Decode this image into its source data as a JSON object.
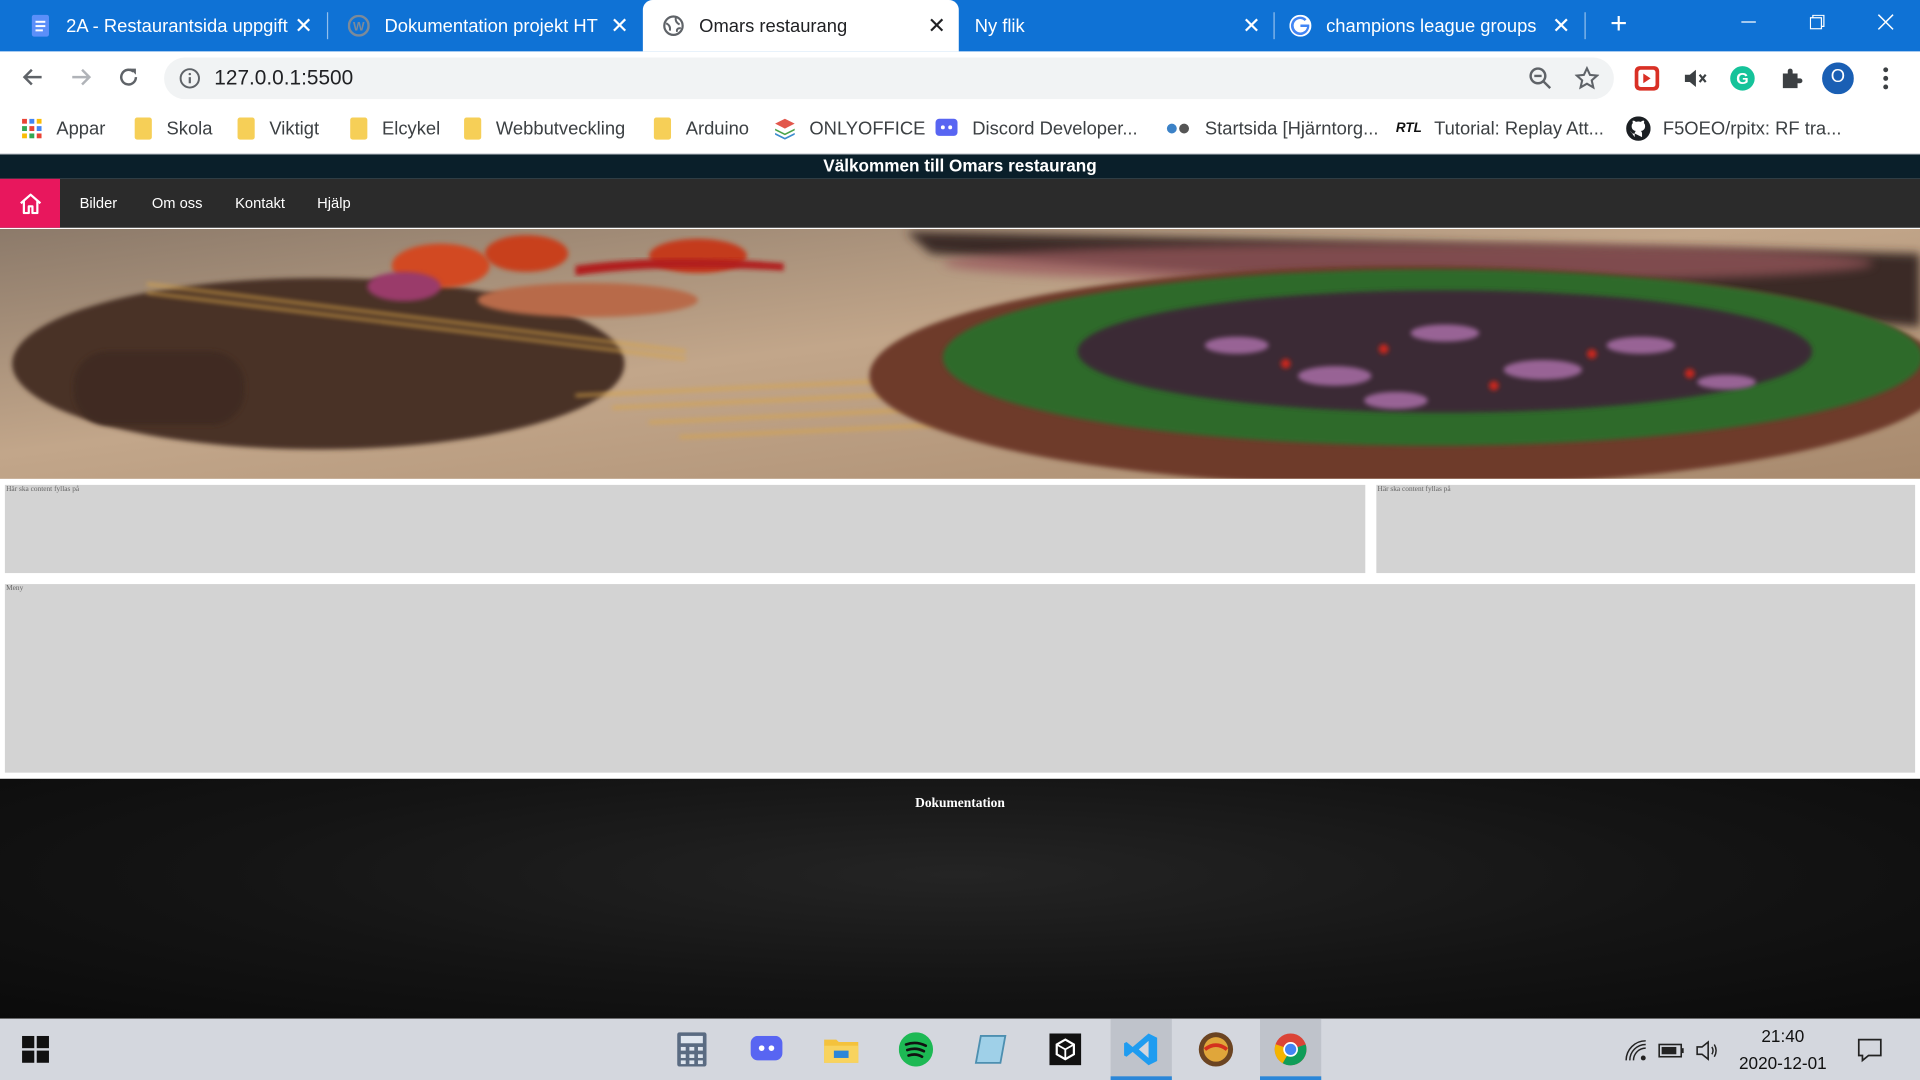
{
  "browser": {
    "tabs": [
      {
        "title": "2A - Restaurantsida uppgift",
        "icon": "google-docs-icon"
      },
      {
        "title": "Dokumentation projekt HT",
        "icon": "wordpress-icon"
      },
      {
        "title": "Omars restaurang",
        "icon": "globe-icon",
        "active": true
      },
      {
        "title": "Ny flik",
        "icon": ""
      },
      {
        "title": "champions league groups",
        "icon": "google-icon"
      }
    ],
    "url": "127.0.0.1:5500",
    "profile_initial": "O",
    "bookmarks": [
      {
        "label": "Appar",
        "icon": "apps-grid-icon"
      },
      {
        "label": "Skola",
        "icon": "folder-icon"
      },
      {
        "label": "Viktigt",
        "icon": "folder-icon"
      },
      {
        "label": "Elcykel",
        "icon": "folder-icon"
      },
      {
        "label": "Webbutveckling",
        "icon": "folder-icon"
      },
      {
        "label": "Arduino",
        "icon": "folder-icon"
      },
      {
        "label": "ONLYOFFICE",
        "icon": "onlyoffice-icon"
      },
      {
        "label": "Discord Developer...",
        "icon": "discord-icon"
      },
      {
        "label": "Startsida [Hjärntorg...",
        "icon": "hjarntorget-icon"
      },
      {
        "label": "Tutorial: Replay Att...",
        "icon": "rtl-icon",
        "icon_text": "RTL"
      },
      {
        "label": "F5OEO/rpitx: RF tra...",
        "icon": "github-icon"
      }
    ]
  },
  "page": {
    "header": "Välkommen till Omars restaurang",
    "nav": [
      "Bilder",
      "Om oss",
      "Kontakt",
      "Hjälp"
    ],
    "box_left_text": "Här ska content fyllas på",
    "box_right_text": "Här ska content fyllas på",
    "box_wide_text": "Meny",
    "footer_title": "Dokumentation"
  },
  "taskbar": {
    "apps": [
      "calculator-icon",
      "discord-icon",
      "file-explorer-icon",
      "spotify-icon",
      "notes-icon",
      "unity-icon",
      "vscode-icon",
      "game-icon",
      "chrome-icon"
    ],
    "time": "21:40",
    "date": "2020-12-01"
  },
  "colors": {
    "tabstrip": "#0f72d5",
    "home_button": "#e8175d",
    "site_nav": "#2b2b2b",
    "site_header": "#0a1f2a",
    "content_box": "#d3d3d3"
  }
}
